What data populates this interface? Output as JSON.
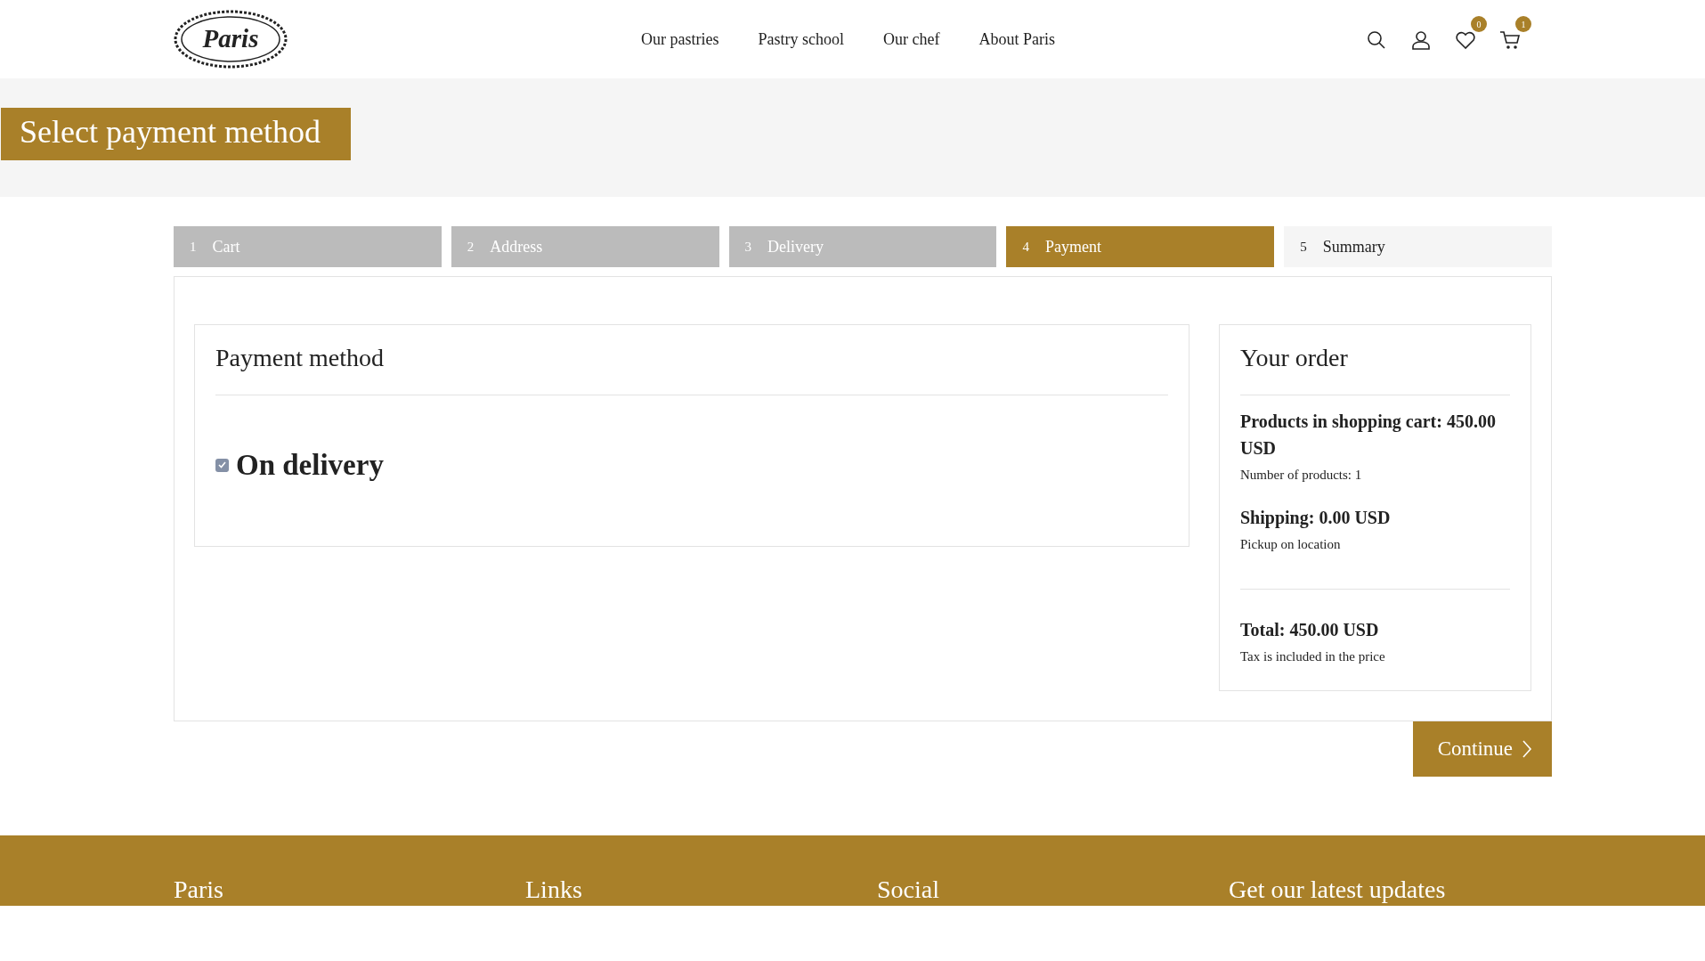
{
  "header": {
    "logo": "Paris",
    "nav": [
      "Our pastries",
      "Pastry school",
      "Our chef",
      "About Paris"
    ],
    "icons": [
      {
        "kind": "search"
      },
      {
        "kind": "user"
      },
      {
        "kind": "heart",
        "badge": "0"
      },
      {
        "kind": "cart",
        "badge": "1"
      }
    ]
  },
  "page_title": "Select payment method",
  "steps": [
    {
      "number": "1",
      "label": "Cart",
      "selected": false,
      "completed": true
    },
    {
      "number": "2",
      "label": "Address",
      "selected": false,
      "completed": true
    },
    {
      "number": "3",
      "label": "Delivery",
      "selected": false,
      "completed": true
    },
    {
      "number": "4",
      "label": "Payment",
      "selected": true,
      "completed": false
    },
    {
      "number": "5",
      "label": "Summary",
      "selected": false,
      "completed": false
    }
  ],
  "payment": {
    "title": "Payment method",
    "options": [
      {
        "label": "On delivery",
        "checked": true
      }
    ]
  },
  "order": {
    "title": "Your order",
    "lines": [
      {
        "title": "Products in shopping cart: 450.00 USD",
        "note": "Number of products: 1"
      },
      {
        "title": "Shipping: 0.00 USD",
        "note": "Pickup on location"
      }
    ],
    "total": {
      "title": "Total: 450.00 USD",
      "note": "Tax is included in the price"
    }
  },
  "continue_button": "Continue",
  "footer": [
    "Paris",
    "Links",
    "Social",
    "Get our latest updates"
  ]
}
